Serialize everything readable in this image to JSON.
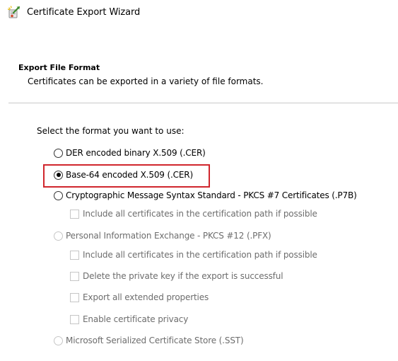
{
  "window": {
    "title": "Certificate Export Wizard",
    "icon": "certificate-wizard-icon"
  },
  "header": {
    "title": "Export File Format",
    "description": "Certificates can be exported in a variety of file formats."
  },
  "prompt": "Select the format you want to use:",
  "options": [
    {
      "label": "DER encoded binary X.509 (.CER)",
      "selected": false,
      "enabled": true
    },
    {
      "label": "Base-64 encoded X.509 (.CER)",
      "selected": true,
      "enabled": true
    },
    {
      "label": "Cryptographic Message Syntax Standard - PKCS #7 Certificates (.P7B)",
      "selected": false,
      "enabled": true
    },
    {
      "label": "Personal Information Exchange - PKCS #12 (.PFX)",
      "selected": false,
      "enabled": false
    },
    {
      "label": "Microsoft Serialized Certificate Store (.SST)",
      "selected": false,
      "enabled": false
    }
  ],
  "pkcs7_options": [
    {
      "label": "Include all certificates in the certification path if possible",
      "checked": false,
      "enabled": false
    }
  ],
  "pfx_options": [
    {
      "label": "Include all certificates in the certification path if possible",
      "checked": false,
      "enabled": false
    },
    {
      "label": "Delete the private key if the export is successful",
      "checked": false,
      "enabled": false
    },
    {
      "label": "Export all extended properties",
      "checked": false,
      "enabled": false
    },
    {
      "label": "Enable certificate privacy",
      "checked": false,
      "enabled": false
    }
  ],
  "colors": {
    "highlight": "#d0262d",
    "disabled_text": "#6d6d6d"
  }
}
